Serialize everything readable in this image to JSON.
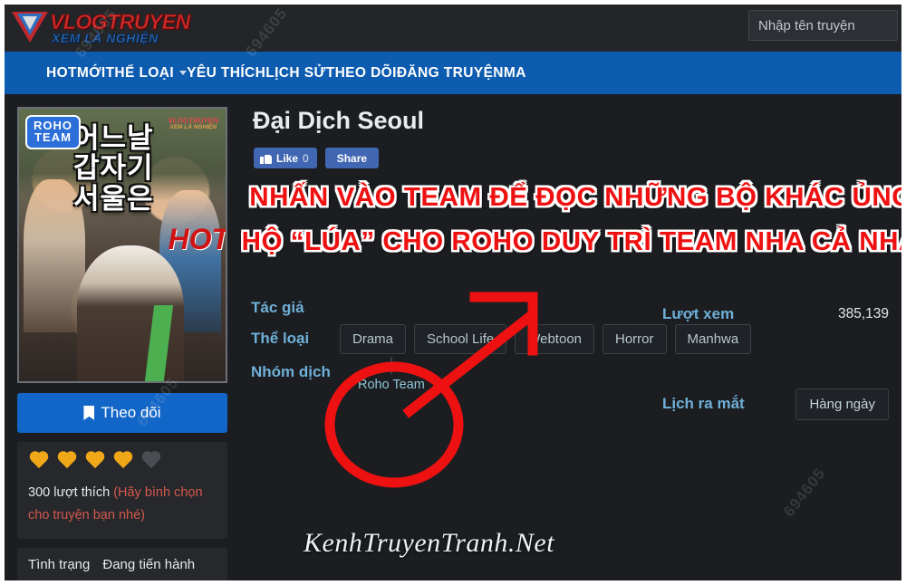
{
  "site": {
    "logo_primary": "VLOGTRUYEN",
    "logo_secondary": "XEM LÀ NGHIỆN",
    "watermark_id": "694605",
    "bottom_watermark": "KenhTruyenTranh.Net",
    "accent_blue": "#0d5cb0",
    "label_blue": "#6fb0d8",
    "annotation_red": "#ee1111"
  },
  "search": {
    "placeholder": "Nhập tên truyện",
    "value": ""
  },
  "nav": {
    "items": [
      {
        "label": "HOT",
        "has_caret": false
      },
      {
        "label": "MỚI",
        "has_caret": false
      },
      {
        "label": "THỂ LOẠI",
        "has_caret": true
      },
      {
        "label": "YÊU THÍCH",
        "has_caret": false
      },
      {
        "label": "LỊCH SỬ",
        "has_caret": false
      },
      {
        "label": "THEO DÕI",
        "has_caret": false
      },
      {
        "label": "ĐĂNG TRUYỆN",
        "has_caret": false
      },
      {
        "label": "MA",
        "has_caret": false
      }
    ]
  },
  "cover": {
    "team_badge_line1": "ROHO",
    "team_badge_line2": "TEAM",
    "korean_title": "어느날 갑자기 서울은",
    "vlog_mark_1": "VLOGTRUYEN",
    "vlog_mark_2": "XEM LÀ NGHIỆN",
    "hot_mark": "HOT"
  },
  "sidebar": {
    "follow_label": "Theo dõi",
    "hearts_filled": 4,
    "hearts_total": 5,
    "like_count_text": "300 lượt thích",
    "like_note": "(Hãy bình chọn cho truyện bạn nhé)",
    "status_label": "Tình trạng",
    "status_value": "Đang tiến hành"
  },
  "main": {
    "title": "Đại Dịch Seoul",
    "like_button_label": "Like",
    "like_count": "0",
    "share_button_label": "Share",
    "banner_line_1": "NHẤN VÀO TEAM ĐỂ ĐỌC NHỮNG BỘ KHÁC ỦNG",
    "banner_line_2": "HỘ “LÚA” CHO ROHO DUY TRÌ TEAM NHA CẢ NHÀ!!",
    "author_label": "Tác giả",
    "author_value": "",
    "genre_label": "Thể loại",
    "genres": [
      "Drama",
      "School Life",
      "Webtoon",
      "Horror",
      "Manhwa"
    ],
    "team_label": "Nhóm dịch",
    "team_name": "Roho Team",
    "views_label": "Lượt xem",
    "views_value": "385,139",
    "schedule_label": "Lịch ra mắt",
    "schedule_value": "Hàng ngày"
  }
}
